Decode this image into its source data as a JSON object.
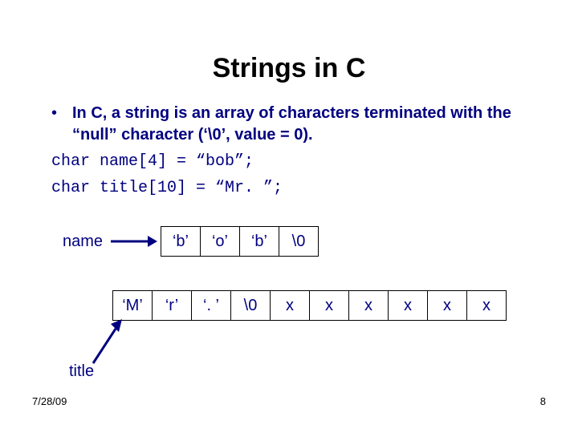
{
  "title": "Strings in C",
  "bullet": "In C, a string is an array of characters terminated with the “null” character (‘\\0’, value = 0).",
  "code_line1": "char name[4] = “bob”;",
  "code_line2": "char title[10] = “Mr. ”;",
  "diagram1": {
    "label": "name",
    "cells": [
      "‘b’",
      "‘o’",
      "‘b’",
      "\\0"
    ]
  },
  "diagram2": {
    "label": "title",
    "cells": [
      "‘M’",
      "‘r’",
      "‘. ’",
      "\\0",
      "x",
      "x",
      "x",
      "x",
      "x",
      "x"
    ]
  },
  "footer": {
    "date": "7/28/09",
    "page": "8"
  }
}
